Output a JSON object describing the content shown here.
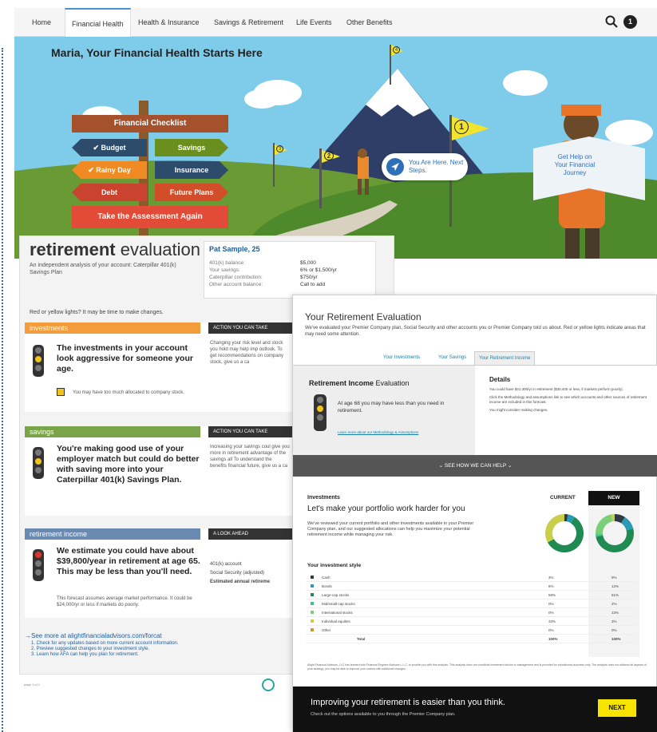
{
  "nav": {
    "items": [
      "Home",
      "Financial Health",
      "Health & Insurance",
      "Savings & Retirement",
      "Life Events",
      "Other Benefits"
    ],
    "active_index": 1,
    "notifications": "1"
  },
  "hero": {
    "title": "Maria, Your Financial Health Starts Here",
    "checklist_title": "Financial Checklist",
    "signs": [
      {
        "label": "Budget",
        "color": "#2d4b6b",
        "checked": true
      },
      {
        "label": "Savings",
        "color": "#6b8f1f",
        "checked": false
      },
      {
        "label": "Rainy Day",
        "color": "#f08a22",
        "checked": true
      },
      {
        "label": "Insurance",
        "color": "#2d4b6b",
        "checked": false
      },
      {
        "label": "Debt",
        "color": "#c9432f",
        "checked": false
      },
      {
        "label": "Future Plans",
        "color": "#d24e2b",
        "checked": false
      }
    ],
    "assessment_button": "Take the Assessment Again",
    "you_are_here": "You Are Here. Next Steps.",
    "help_text": "Get Help on Your Financial Journey",
    "flags": [
      "1",
      "2",
      "3",
      "4"
    ]
  },
  "doc": {
    "title_bold": "retirement",
    "title_rest": " evaluation",
    "subtitle": "An independent analysis of your account: Caterpillar 401(k) Savings Plan",
    "red_yellow": "Red or yellow lights? It may be time to make changes.",
    "person": {
      "name": "Pat Sample, 25",
      "rows": [
        {
          "label": "401(k) balance:",
          "value": "$5,000"
        },
        {
          "label": "Your savings:",
          "value": "6% or $1,500/yr"
        },
        {
          "label": "Caterpillar contribution:",
          "value": "$750/yr"
        },
        {
          "label": "Other account balance:",
          "value": "Call to add"
        }
      ]
    },
    "sections": [
      {
        "header": "investments",
        "action": "ACTION YOU CAN TAKE",
        "message": "The investments in your account look aggressive for someone your age.",
        "note": "You may have too much allocated to company stock.",
        "side": "Changing your risk level and stock you hold may help imp outlook. To get recommendations on company stock, give us a ca"
      },
      {
        "header": "savings",
        "action": "ACTION YOU CAN TAKE",
        "message": "You're making good use of your employer match but could do better with saving more into your Caterpillar 401(k) Savings Plan.",
        "side": "Increasing your savings coul give you more in retirement advantage of the savings all To understand the benefits financial future, give us a ca"
      },
      {
        "header": "retirement income",
        "action": "A LOOK AHEAD",
        "message": "We estimate you could have about $39,800/year in retirement at age 65. This may be less than you'll need.",
        "note": "This forecast assumes average market performance. It could be $24,000/yr or less if markets do poorly.",
        "side_rows": [
          "401(k) account",
          "Social Security (adjusted)",
          "Estimated annual retireme"
        ]
      }
    ],
    "see_more": "See more at alightfinancialadvisors.com/forcat",
    "steps": [
      "1. Check for any updates based on more current account information.",
      "2. Preview suggested changes to your investment style.",
      "3. Learn how AFA can help you plan for retirement."
    ],
    "page": "page 1 of 1"
  },
  "panel": {
    "title": "Your Retirement Evaluation",
    "intro": "We've evaluated your Premier Company plan, Social Security and other accounts you or Premier Company told us about. Red or yellow lights indicate areas that may need some attention.",
    "tabs": [
      "Your Investments",
      "Your Savings",
      "Your Retirement Income"
    ],
    "income_title_bold": "Retirement Income",
    "income_title_rest": " Evaluation",
    "income_msg": "At age 68 you may have less than you need in retirement.",
    "method_link": "Learn more about our Methodology & Assumptions",
    "details_title": "Details",
    "details": [
      "You could have $41,300/yr in retirement ($30,400 or less, if markets perform poorly).",
      "Click the Methodology and assumptions link to see which accounts and other sources of retirement income are included in this forecast.",
      "You might consider making changes."
    ],
    "help_bar": "SEE HOW WE CAN HELP",
    "inv_label": "Investments",
    "inv_title": "Let's make your portfolio work harder for you",
    "inv_text": "We've reviewed your current portfolio and other investments available in your Premier Company plan, and our suggested allocations can help you maximize your potential retirement income while managing your risk.",
    "current_label": "CURRENT",
    "new_label": "NEW",
    "style_title": "Your investment style",
    "rows": [
      {
        "name": "Cash",
        "current": "3%",
        "new": "9%",
        "color": "#2e3a45"
      },
      {
        "name": "Bonds",
        "current": "6%",
        "new": "12%",
        "color": "#2a9bb5"
      },
      {
        "name": "Large-cap stocks",
        "current": "58%",
        "new": "51%",
        "color": "#1f8a52"
      },
      {
        "name": "Mid/small-cap stocks",
        "current": "0%",
        "new": "2%",
        "color": "#3fbf8a"
      },
      {
        "name": "International stocks",
        "current": "0%",
        "new": "23%",
        "color": "#7ccf7a"
      },
      {
        "name": "Individual equities",
        "current": "33%",
        "new": "3%",
        "color": "#c8d04a"
      },
      {
        "name": "Other",
        "current": "0%",
        "new": "0%",
        "color": "#c79a2a"
      },
      {
        "name": "Total",
        "current": "100%",
        "new": "100%",
        "color": ""
      }
    ],
    "disclaimer": "Alight Financial Advisors, LLC has teamed with Financial Engines Advisors L.L.C. to provide you with this analysis. This analysis does not constitute investment advice or management and is provided for educational purposes only. The analysis does not address all aspects of your strategy; you may be able to improve your outlook with additional changes.",
    "footer_title": "Improving your retirement is easier than you think.",
    "footer_sub": "Check out the options available to you through the Premier Company plan.",
    "next": "NEXT"
  }
}
